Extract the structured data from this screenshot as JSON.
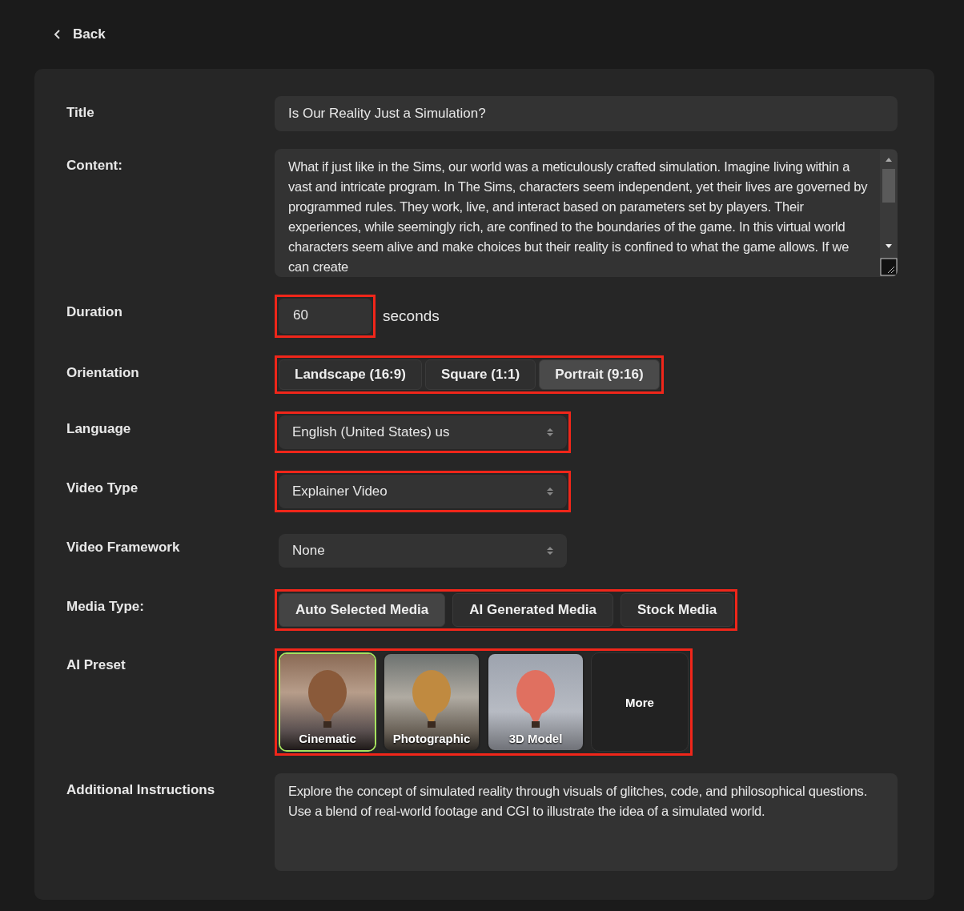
{
  "back_link": {
    "label": "Back"
  },
  "form": {
    "title": {
      "label": "Title",
      "value": "Is Our Reality Just a Simulation?"
    },
    "content": {
      "label": "Content:",
      "value": "What if just like in the Sims, our world was a meticulously crafted simulation. Imagine living within a vast and intricate program. In The Sims, characters seem independent, yet their lives are governed by programmed rules. They work, live, and interact based on parameters set by players. Their experiences, while seemingly rich, are confined to the boundaries of the game. In this virtual world characters seem alive and make choices but their reality is confined to what the game allows. If we can create"
    },
    "duration": {
      "label": "Duration",
      "value": "60",
      "unit": "seconds",
      "highlighted": true
    },
    "orientation": {
      "label": "Orientation",
      "highlighted": true,
      "options": [
        {
          "label": "Landscape (16:9)",
          "selected": false
        },
        {
          "label": "Square (1:1)",
          "selected": false
        },
        {
          "label": "Portrait (9:16)",
          "selected": true
        }
      ]
    },
    "language": {
      "label": "Language",
      "value": "English (United States) us",
      "highlighted": true
    },
    "video_type": {
      "label": "Video Type",
      "value": "Explainer Video",
      "highlighted": true
    },
    "video_framework": {
      "label": "Video Framework",
      "value": "None",
      "highlighted": false
    },
    "media_type": {
      "label": "Media Type:",
      "highlighted": true,
      "options": [
        {
          "label": "Auto Selected Media",
          "selected": true
        },
        {
          "label": "AI Generated Media",
          "selected": false
        },
        {
          "label": "Stock Media",
          "selected": false
        }
      ]
    },
    "ai_preset": {
      "label": "AI Preset",
      "highlighted": true,
      "presets": [
        {
          "kind": "image",
          "label": "Cinematic",
          "selected": true
        },
        {
          "kind": "image",
          "label": "Photographic",
          "selected": false
        },
        {
          "kind": "image",
          "label": "3D Model",
          "selected": false
        },
        {
          "kind": "more",
          "label": "More",
          "selected": false
        }
      ]
    },
    "additional_instructions": {
      "label": "Additional Instructions",
      "value": "Explore the concept of simulated reality through visuals of glitches, code, and philosophical questions. Use a blend of real-world footage and CGI to illustrate the idea of a simulated world."
    }
  }
}
